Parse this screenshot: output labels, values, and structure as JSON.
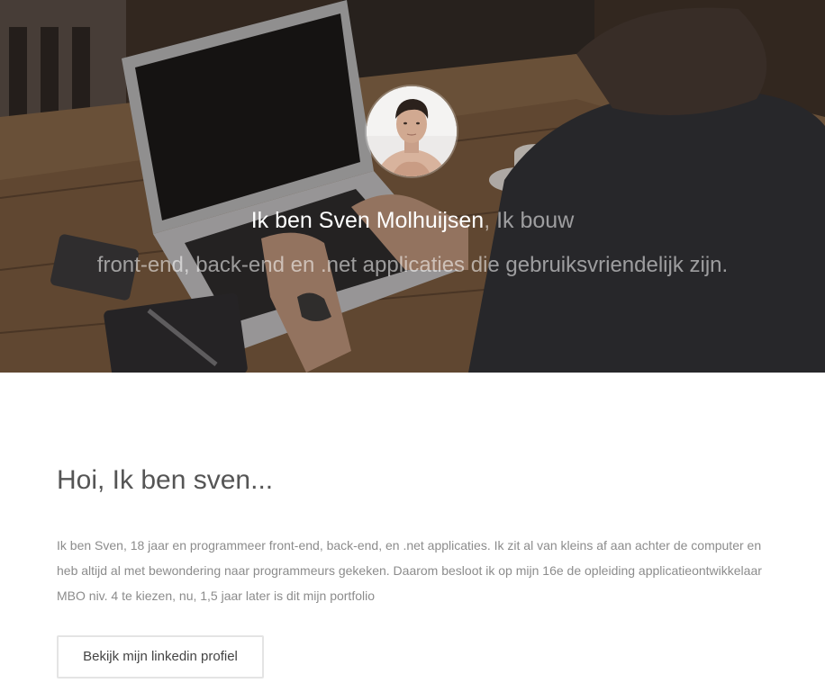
{
  "hero": {
    "name": "Ik ben Sven Molhuijsen",
    "name_suffix": ", Ik bouw",
    "tagline": "front-end, back-end en .net applicaties die gebruiksvriendelijk zijn.",
    "avatar_icon": "profile-photo"
  },
  "about": {
    "title": "Hoi, Ik ben sven...",
    "text": "Ik ben Sven, 18 jaar en programmeer front-end, back-end, en .net applicaties. Ik zit al van kleins af aan achter de computer en heb altijd al met bewondering naar programmeurs gekeken. Daarom besloot ik op mijn 16e de opleiding applicatieontwikkelaar MBO niv. 4 te kiezen, nu, 1,5 jaar later is dit mijn portfolio",
    "button_label": "Bekijk mijn linkedin profiel"
  },
  "colors": {
    "title": "#555555",
    "body_text": "#8c8c8c",
    "button_border": "#e4e4e4",
    "hero_text_dim": "rgba(255,255,255,0.55)"
  }
}
